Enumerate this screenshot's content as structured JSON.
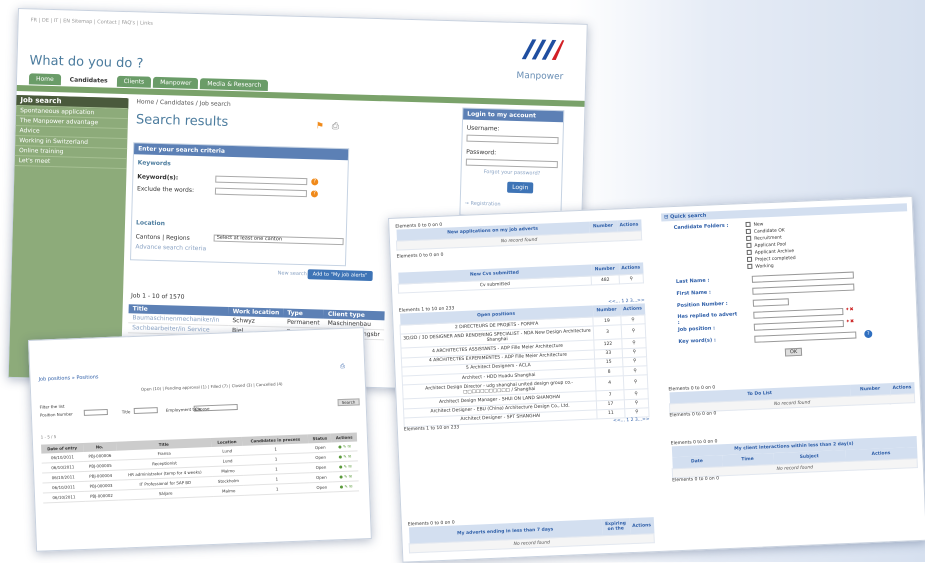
{
  "w1": {
    "topnav": "FR | DE | IT | EN   Sitemap | Contact | FAQ's | Links",
    "tagline": "What do you do ?",
    "brand": "Manpower",
    "tabs": [
      "Home",
      "Candidates",
      "Clients",
      "Manpower",
      "Media & Research"
    ],
    "side_header": "Job search",
    "side_items": [
      "Spontaneous application",
      "The Manpower advantage",
      "Advice",
      "Working in Switzerland",
      "Online training",
      "Let's meet"
    ],
    "breadcrumb": "Home / Candidates / Job search",
    "title": "Search results",
    "criteria_header": "Enter your search criteria",
    "keywords_title": "Keywords",
    "keyword_label": "Keyword(s):",
    "exclude_label": "Exclude the words:",
    "location_title": "Location",
    "cantons_label": "Cantons | Regions",
    "canton_select": "Select at least one canton",
    "advanced": "Advance search criteria",
    "new_search": "New search",
    "add_button": "Add to \"My job alerts\"",
    "login": {
      "header": "Login to my account",
      "username": "Username:",
      "password": "Password:",
      "forgot": "Forgot your password?",
      "button": "Login",
      "registration": "→ Registration"
    },
    "results_count": "Job 1 - 10 of 1570",
    "table_headers": [
      "Title",
      "Work location",
      "Type",
      "Client type"
    ],
    "rows": [
      [
        "Baumaschinenmechaniker/in",
        "Schwyz",
        "Permanent",
        "Maschinenbau"
      ],
      [
        "Sachbearbeiter/in Service",
        "Biel",
        "Permanent",
        "Dienstleistungsbr"
      ]
    ]
  },
  "w2": {
    "title": "Job positions » Positions",
    "filter_line": "Open (10) | Pending approval (1) | Filled (7) | Closed (3) | Cancelled (4)",
    "filter_label": "Filter the list",
    "pos_num": "Position Number",
    "title_label": "Title",
    "emp_type": "Employment type",
    "emp_choose": "Choose",
    "search_btn": "Search",
    "count": "1 - 5 / 5",
    "headers": [
      "Date of entry",
      "No.",
      "Title",
      "Location",
      "Candidates in process",
      "Status",
      "Actions"
    ],
    "rows": [
      [
        "06/10/2011",
        "PBJ-000006",
        "Fransa",
        "Lund",
        "1",
        "Open"
      ],
      [
        "06/10/2011",
        "PBJ-000005",
        "Receptionist",
        "Lund",
        "1",
        "Open"
      ],
      [
        "06/10/2011",
        "PBJ-000004",
        "HR administrator (temp for 4 weeks)",
        "Malmo",
        "1",
        "Open"
      ],
      [
        "06/10/2011",
        "PBJ-000003",
        "IT Professional for SAP BD",
        "Stockholm",
        "1",
        "Open"
      ],
      [
        "06/10/2011",
        "PBJ-000002",
        "Säljare",
        "Malmo",
        "1",
        "Open"
      ]
    ]
  },
  "w3": {
    "elements_0": "Elements 0 to 0 on 0",
    "new_app_header": "New applications on my job adverts",
    "number_label": "Number",
    "actions_label": "Actions",
    "no_record": "No record found",
    "new_cvs_header": "New Cvs submitted",
    "cvs_row": [
      "Cv submitted",
      "482"
    ],
    "elements_1_10": "Elements 1 to 10 on 233",
    "pager": "<<...  1 2 3...>>",
    "open_positions_header": "Open positions",
    "positions": [
      [
        "2 DIRECTEURS DE PROJETS - FORM'A",
        "19"
      ],
      [
        "3D/2D / 3D DESIGNER AND RENDERING SPECIALIST - NDA New Design Architecture Shanghai",
        "3"
      ],
      [
        "4 ARCHITECTES ASSISTANTS - ADP Fille Meier Architecture",
        "122"
      ],
      [
        "4 ARCHITECTES EXPERIMENTES - ADP Fille Meier Architecture",
        "33"
      ],
      [
        "5 Architect Designers - ACLA",
        "15"
      ],
      [
        "Architect - HDD Huadu Shanghai",
        "8"
      ],
      [
        "Architect Design Director - udg shanghai united design group co.-□□□□□□□□□□□ / Shanghai",
        "4"
      ],
      [
        "Architect Design Manager - SHUI ON LAND SHANGHAI",
        "7"
      ],
      [
        "Architect Designer - EBU (China) Architecture Design Co., Ltd.",
        "17"
      ],
      [
        "Architect Designer - SPT SHANGHAI",
        "11"
      ]
    ],
    "adverts_header": "My adverts ending in less than 7 days",
    "expiring_label": "Expiring on the",
    "quick": {
      "header": "⊟ Quick search",
      "folders_label": "Candidate Folders :",
      "folders": [
        "New",
        "Candidate OK",
        "Recruitment",
        "Applicant Pool",
        "Applicant Archive",
        "Project completed",
        "Working"
      ],
      "last_name": "Last Name :",
      "first_name": "First Name :",
      "pos_number": "Position Number :",
      "replied": "Has replied to advert :",
      "job_position": "Job position :",
      "keywords": "Key word(s) :",
      "ok": "OK"
    },
    "todo_header": "To Do List",
    "interactions_header": "My client interactions within less than 2 day(s)",
    "int_headers": [
      "Date",
      "Time",
      "Subject",
      "Actions"
    ]
  }
}
